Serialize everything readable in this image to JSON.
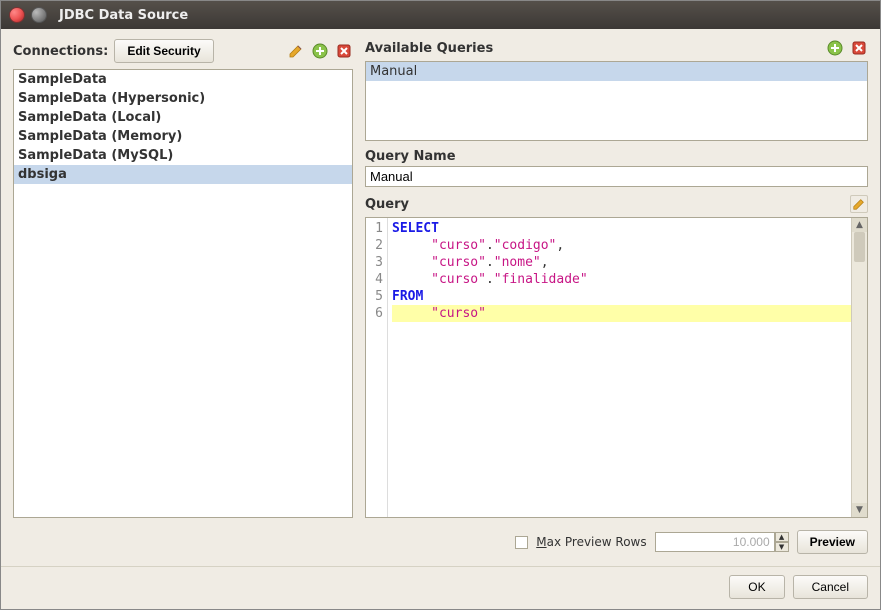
{
  "window": {
    "title": "JDBC Data Source"
  },
  "left": {
    "connections_label": "Connections:",
    "edit_security_label": "Edit Security",
    "connections": [
      {
        "name": "SampleData",
        "selected": false
      },
      {
        "name": "SampleData (Hypersonic)",
        "selected": false
      },
      {
        "name": "SampleData (Local)",
        "selected": false
      },
      {
        "name": "SampleData (Memory)",
        "selected": false
      },
      {
        "name": "SampleData (MySQL)",
        "selected": false
      },
      {
        "name": "dbsiga",
        "selected": true
      }
    ]
  },
  "right": {
    "available_queries_label": "Available Queries",
    "queries": [
      {
        "name": "Manual",
        "selected": true
      }
    ],
    "query_name_label": "Query Name",
    "query_name_value": "Manual",
    "query_label": "Query",
    "query_lines": [
      {
        "n": 1,
        "tokens": [
          {
            "t": "SELECT",
            "c": "kw"
          }
        ],
        "hl": false
      },
      {
        "n": 2,
        "tokens": [
          {
            "t": "     ",
            "c": ""
          },
          {
            "t": "\"curso\"",
            "c": "str"
          },
          {
            "t": ".",
            "c": ""
          },
          {
            "t": "\"codigo\"",
            "c": "str"
          },
          {
            "t": ",",
            "c": ""
          }
        ],
        "hl": false
      },
      {
        "n": 3,
        "tokens": [
          {
            "t": "     ",
            "c": ""
          },
          {
            "t": "\"curso\"",
            "c": "str"
          },
          {
            "t": ".",
            "c": ""
          },
          {
            "t": "\"nome\"",
            "c": "str"
          },
          {
            "t": ",",
            "c": ""
          }
        ],
        "hl": false
      },
      {
        "n": 4,
        "tokens": [
          {
            "t": "     ",
            "c": ""
          },
          {
            "t": "\"curso\"",
            "c": "str"
          },
          {
            "t": ".",
            "c": ""
          },
          {
            "t": "\"finalidade\"",
            "c": "str"
          }
        ],
        "hl": false
      },
      {
        "n": 5,
        "tokens": [
          {
            "t": "FROM",
            "c": "kw"
          }
        ],
        "hl": false
      },
      {
        "n": 6,
        "tokens": [
          {
            "t": "     ",
            "c": ""
          },
          {
            "t": "\"curso\"",
            "c": "str"
          }
        ],
        "hl": true
      }
    ]
  },
  "bottom": {
    "max_preview_label": "Max Preview Rows",
    "max_preview_value": "10.000",
    "preview_label": "Preview"
  },
  "footer": {
    "ok_label": "OK",
    "cancel_label": "Cancel"
  },
  "icons": {
    "pencil": "pencil-icon",
    "add": "add-icon",
    "remove": "remove-icon"
  }
}
